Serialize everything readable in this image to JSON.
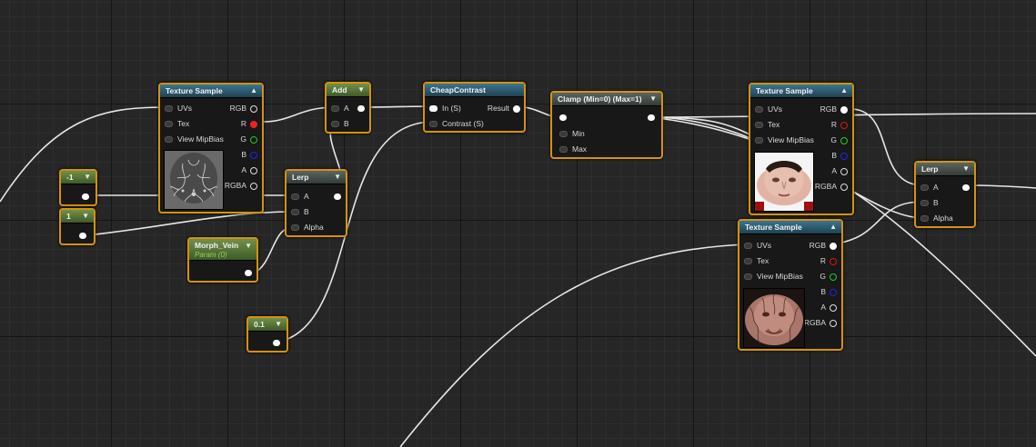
{
  "nodes": {
    "tex1": {
      "title": "Texture Sample",
      "inputs": [
        "UVs",
        "Tex",
        "View MipBias"
      ],
      "outputs": [
        "RGB",
        "R",
        "G",
        "B",
        "A",
        "RGBA"
      ]
    },
    "neg1": {
      "title": "-1"
    },
    "one": {
      "title": "1"
    },
    "add": {
      "title": "Add",
      "inputs": [
        "A",
        "B"
      ]
    },
    "lerp1": {
      "title": "Lerp",
      "inputs": [
        "A",
        "B",
        "Alpha"
      ]
    },
    "morph": {
      "title": "Morph_Vein",
      "subtitle": "Param (0)"
    },
    "point1": {
      "title": "0.1"
    },
    "cheap": {
      "title": "CheapContrast",
      "inputs": [
        "In (S)",
        "Contrast (S)"
      ],
      "outputs": [
        "Result"
      ]
    },
    "clamp": {
      "title": "Clamp (Min=0) (Max=1)",
      "inputs": [
        "Min",
        "Max"
      ]
    },
    "tex2": {
      "title": "Texture Sample",
      "inputs": [
        "UVs",
        "Tex",
        "View MipBias"
      ],
      "outputs": [
        "RGB",
        "R",
        "G",
        "B",
        "A",
        "RGBA"
      ]
    },
    "tex3": {
      "title": "Texture Sample",
      "inputs": [
        "UVs",
        "Tex",
        "View MipBias"
      ],
      "outputs": [
        "RGB",
        "R",
        "G",
        "B",
        "A",
        "RGBA"
      ]
    },
    "lerp2": {
      "title": "Lerp",
      "inputs": [
        "A",
        "B",
        "Alpha"
      ]
    }
  },
  "colors": {
    "node_border": "#d4920f",
    "blue_header": "#2f5f76",
    "green_header": "#5a7a38",
    "wire": "#ffffff"
  },
  "icons": [
    "collapse-arrow-icon",
    "pin-icon",
    "output-pin-icon"
  ]
}
